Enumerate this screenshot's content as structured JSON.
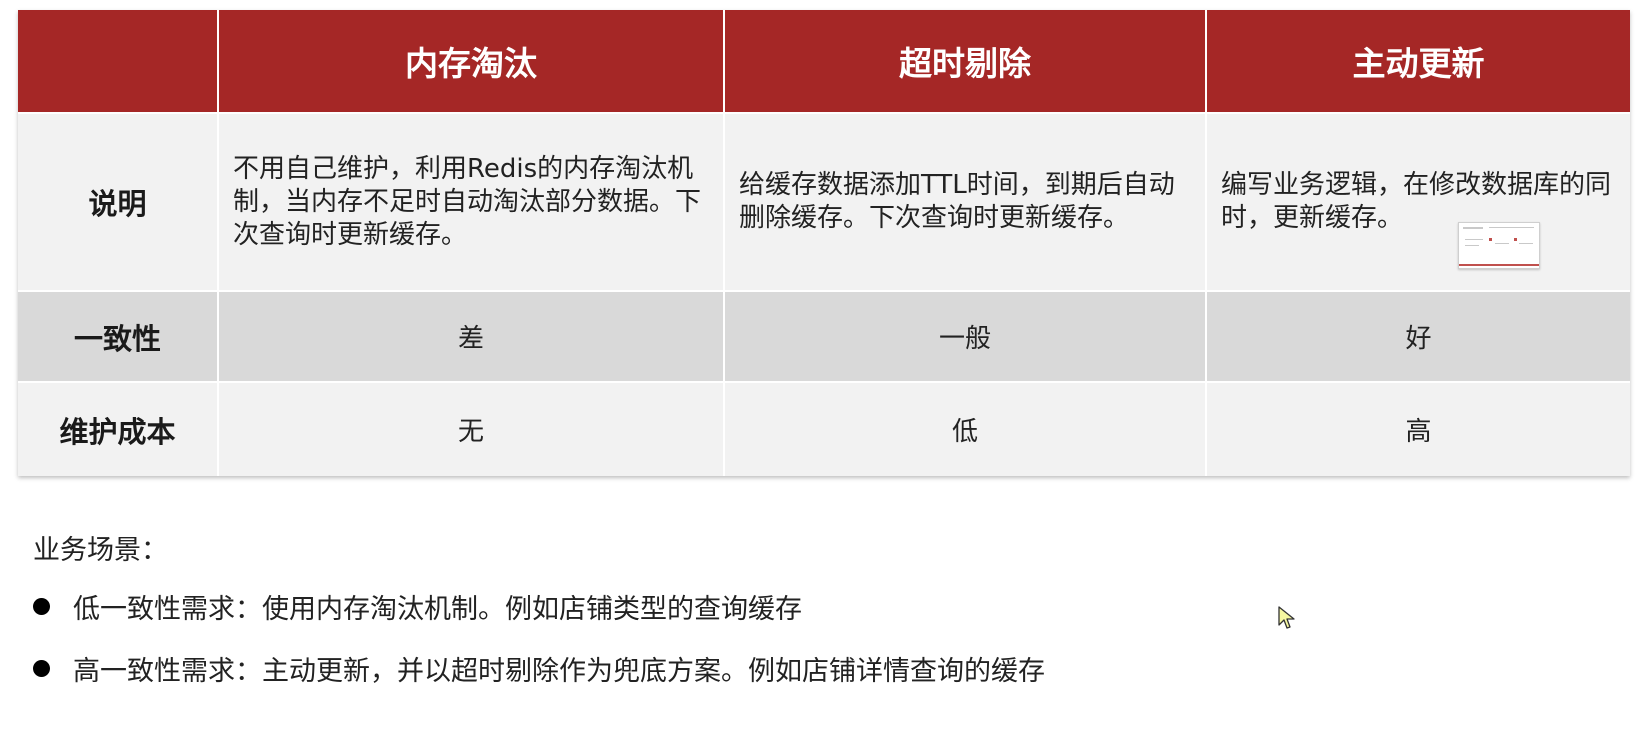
{
  "table": {
    "columns": [
      "",
      "内存淘汰",
      "超时剔除",
      "主动更新"
    ],
    "rows": [
      {
        "label": "说明",
        "cells": [
          "不用自己维护，利用Redis的内存淘汰机制，当内存不足时自动淘汰部分数据。下次查询时更新缓存。",
          "给缓存数据添加TTL时间，到期后自动删除缓存。下次查询时更新缓存。",
          "编写业务逻辑，在修改数据库的同时，更新缓存。"
        ]
      },
      {
        "label": "一致性",
        "cells": [
          "差",
          "一般",
          "好"
        ]
      },
      {
        "label": "维护成本",
        "cells": [
          "无",
          "低",
          "高"
        ]
      }
    ]
  },
  "scenario": {
    "title": "业务场景：",
    "items": [
      "低一致性需求：使用内存淘汰机制。例如店铺类型的查询缓存",
      "高一致性需求：主动更新，并以超时剔除作为兜底方案。例如店铺详情查询的缓存"
    ]
  },
  "colors": {
    "header_bg": "#a52726",
    "header_text": "#ffffff",
    "row_light": "#f2f2f2",
    "row_dark": "#d9d9d9"
  },
  "icons": {
    "cursor": "mouse-pointer-icon",
    "bullet": "bullet-dot-icon"
  }
}
